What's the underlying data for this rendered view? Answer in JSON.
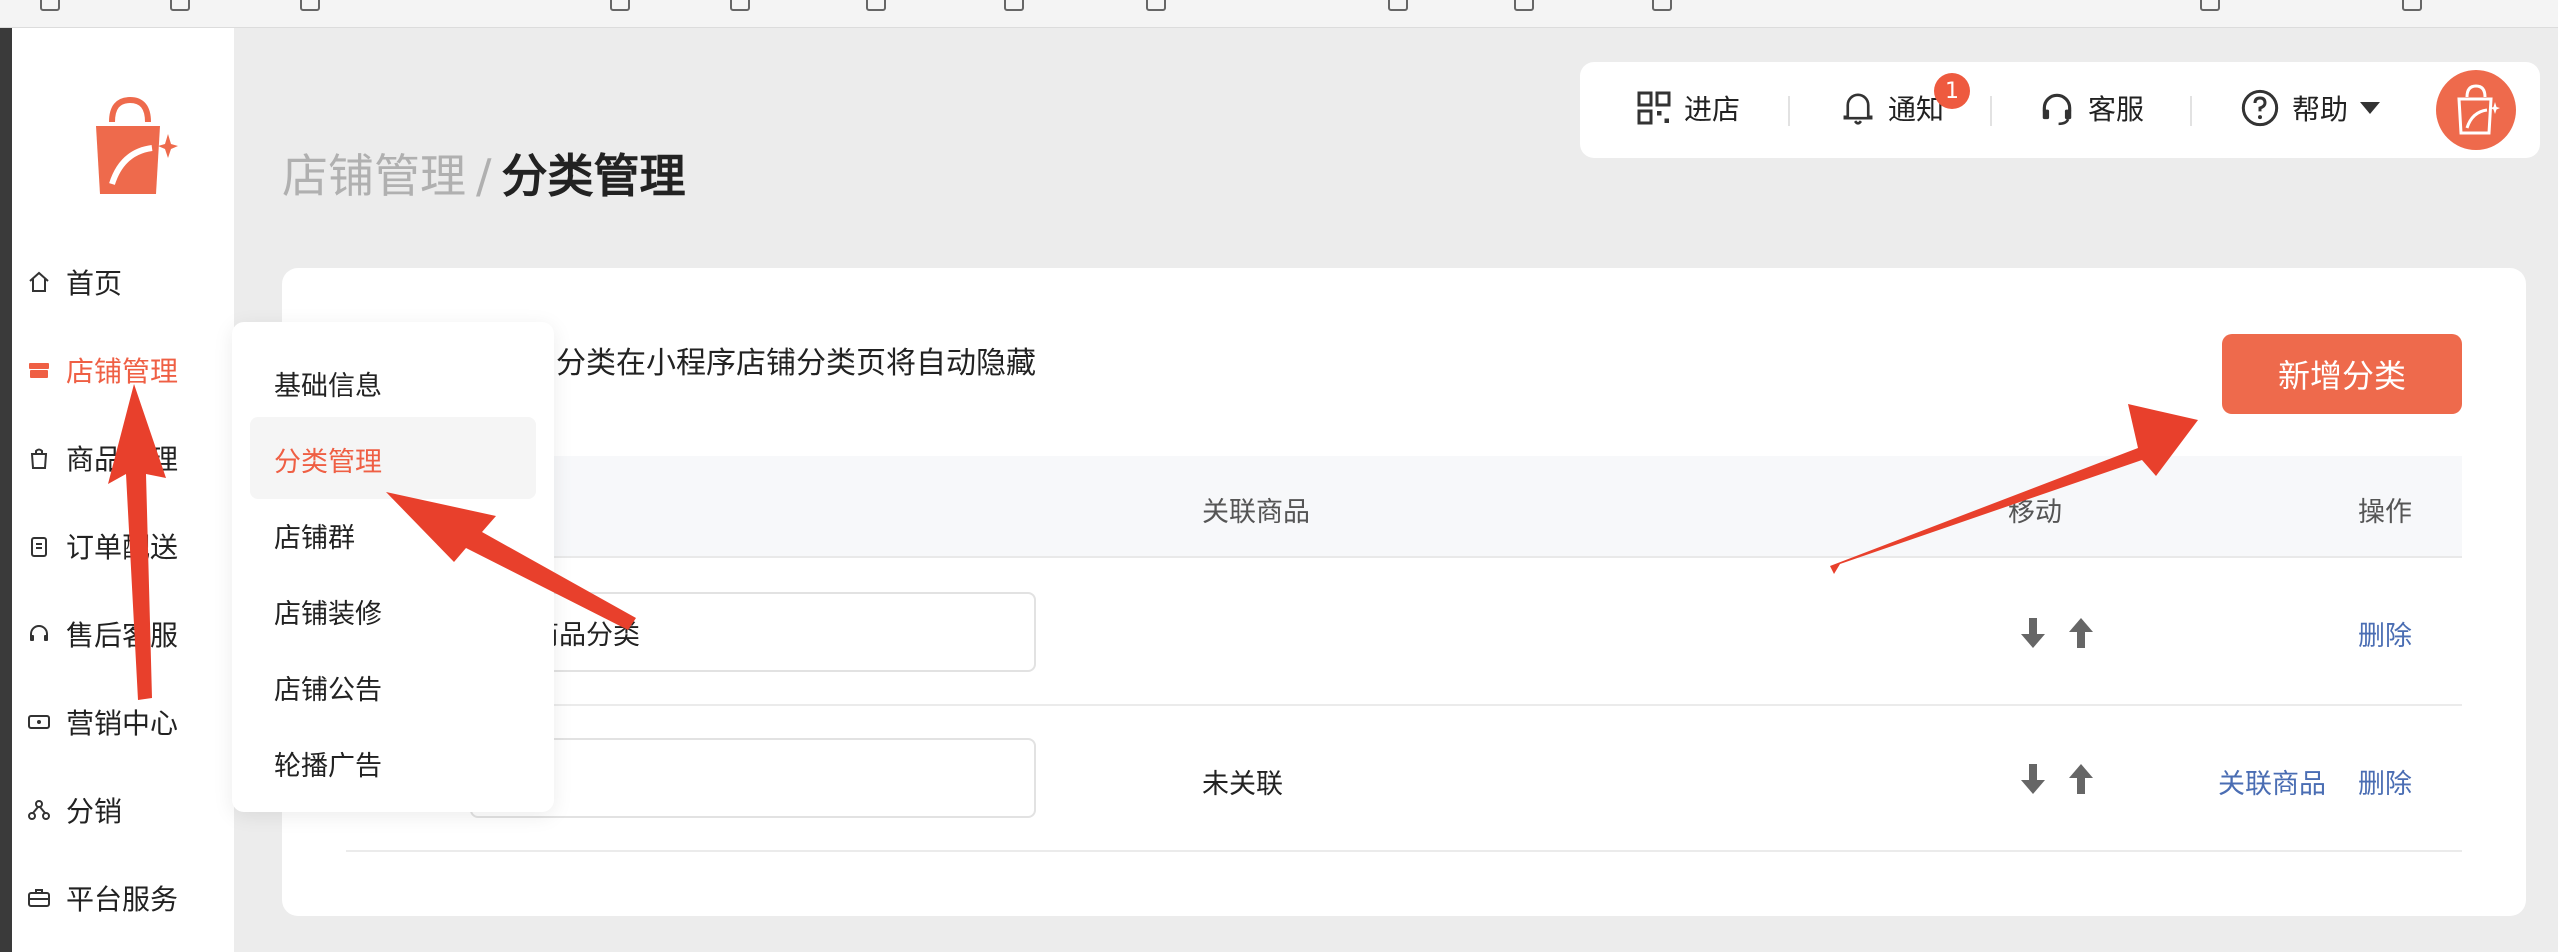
{
  "breadcrumb": {
    "parent": "店铺管理",
    "separator": "/",
    "current": "分类管理"
  },
  "topbar": {
    "enter_store": "进店",
    "notifications": "通知",
    "notification_count": "1",
    "customer_service": "客服",
    "help": "帮助"
  },
  "sidebar": {
    "items": [
      {
        "label": "首页",
        "icon": "home-icon"
      },
      {
        "label": "店铺管理",
        "icon": "store-icon"
      },
      {
        "label": "商品管理",
        "icon": "bag-icon"
      },
      {
        "label": "订单配送",
        "icon": "clipboard-icon"
      },
      {
        "label": "售后客服",
        "icon": "headset-icon"
      },
      {
        "label": "营销中心",
        "icon": "ticket-icon"
      },
      {
        "label": "分销",
        "icon": "share-icon"
      },
      {
        "label": "平台服务",
        "icon": "briefcase-icon"
      }
    ]
  },
  "submenu": {
    "items": [
      {
        "label": "基础信息"
      },
      {
        "label": "分类管理"
      },
      {
        "label": "店铺群"
      },
      {
        "label": "店铺装修"
      },
      {
        "label": "店铺公告"
      },
      {
        "label": "轮播广告"
      }
    ]
  },
  "main": {
    "hint": "的分类在小程序店铺分类页将自动隐藏",
    "add_button": "新增分类",
    "columns": {
      "linked": "关联商品",
      "move": "移动",
      "actions": "操作"
    },
    "rows": [
      {
        "name": "商品分类",
        "linked": "",
        "link_action": "",
        "delete": "删除"
      },
      {
        "name": "",
        "linked": "未关联",
        "link_action": "关联商品",
        "delete": "删除"
      }
    ]
  },
  "colors": {
    "accent": "#ee6a4c",
    "link": "#4a6db3",
    "annotation": "#e8402c"
  }
}
